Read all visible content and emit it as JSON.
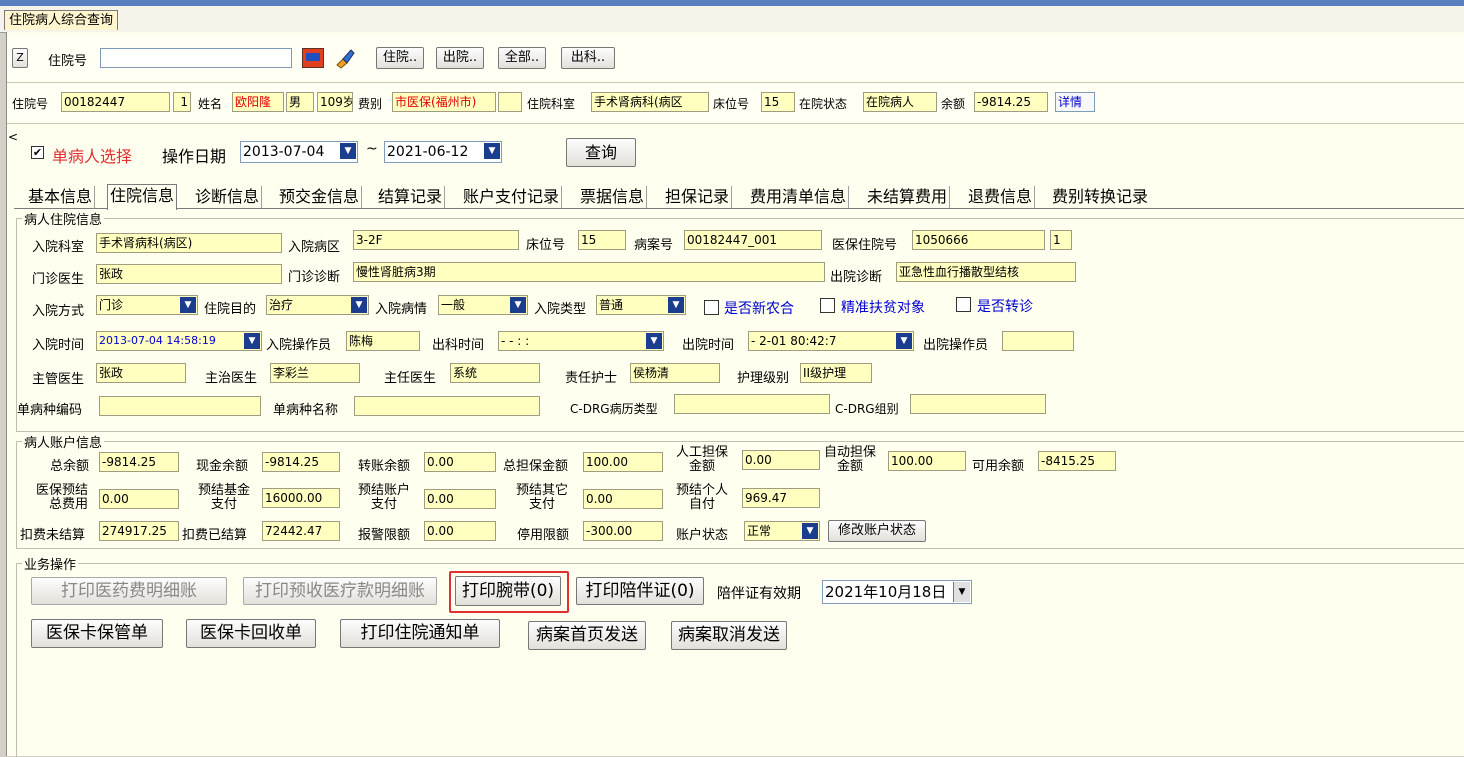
{
  "window": {
    "tab_title": "住院病人综合查询"
  },
  "search_bar": {
    "z_button": "Z",
    "admission_no_label": "住院号",
    "admission_no_value": "",
    "btn_inhospital": "住院..",
    "btn_discharged": "出院..",
    "btn_all": "全部..",
    "btn_out_dept": "出科.."
  },
  "patient_summary": {
    "admission_no_label": "住院号",
    "admission_no": "00182447",
    "times": "1",
    "name_label": "姓名",
    "name": "欧阳隆",
    "sex": "男",
    "age": "109岁",
    "fee_type_label": "费别",
    "fee_type": "市医保(福州市)",
    "dept_label": "住院科室",
    "dept": "手术肾病科(病区",
    "bed_label": "床位号",
    "bed": "15",
    "status_label": "在院状态",
    "status": "在院病人",
    "balance_label": "余额",
    "balance": "-9814.25",
    "detail_button": "详情"
  },
  "filter": {
    "collapse_glyph": "<",
    "single_patient_label": "单病人选择",
    "single_patient_checked": "✔",
    "op_date_label": "操作日期",
    "date_from": "2013-07-04",
    "tilde": "~",
    "date_to": "2021-06-12",
    "query_button": "查询"
  },
  "subtabs": [
    "基本信息",
    "住院信息",
    "诊断信息",
    "预交金信息",
    "结算记录",
    "账户支付记录",
    "票据信息",
    "担保记录",
    "费用清单信息",
    "未结算费用",
    "退费信息",
    "费别转换记录"
  ],
  "admission": {
    "group_title": "病人住院信息",
    "dept_label": "入院科室",
    "dept": "手术肾病科(病区)",
    "ward_label": "入院病区",
    "ward": "3-2F",
    "bed_label": "床位号",
    "bed": "15",
    "record_label": "病案号",
    "record": "00182447_001",
    "ins_no_label": "医保住院号",
    "ins_no": "1050666",
    "ins_seq": "1",
    "op_doctor_label": "门诊医生",
    "op_doctor": "张政",
    "op_diag_label": "门诊诊断",
    "op_diag": "慢性肾脏病3期",
    "dis_diag_label": "出院诊断",
    "dis_diag": "亚急性血行播散型结核",
    "way_label": "入院方式",
    "way": "门诊",
    "purpose_label": "住院目的",
    "purpose": "治疗",
    "cond_label": "入院病情",
    "cond": "一般",
    "type_label": "入院类型",
    "type": "普通",
    "new_coop_label": "是否新农合",
    "poverty_label": "精准扶贫对象",
    "transfer_label": "是否转诊",
    "adm_time_label": "入院时间",
    "adm_time": "2013-07-04 14:58:19",
    "adm_op_label": "入院操作员",
    "adm_op": "陈梅",
    "out_dept_time_label": "出科时间",
    "out_dept_time": "  -  -     :  :",
    "dis_time_label": "出院时间",
    "dis_time": "  - 2-01 80:42:7",
    "dis_op_label": "出院操作员",
    "dis_op": "",
    "chief_doctor_label": "主管医生",
    "chief_doctor": "张政",
    "attending_label": "主治医生",
    "attending": "李彩兰",
    "director_label": "主任医生",
    "director": "系统",
    "nurse_label": "责任护士",
    "nurse": "侯杨清",
    "care_level_label": "护理级别",
    "care_level": "II级护理",
    "disease_code_label": "单病种编码",
    "disease_code": "",
    "disease_name_label": "单病种名称",
    "disease_name": "",
    "cdrg_type_label": "C-DRG病历类型",
    "cdrg_type": "",
    "cdrg_group_label": "C-DRG组别",
    "cdrg_group": ""
  },
  "account": {
    "group_title": "病人账户信息",
    "total_balance_label": "总余额",
    "total_balance": "-9814.25",
    "cash_balance_label": "现金余额",
    "cash_balance": "-9814.25",
    "transfer_balance_label": "转账余额",
    "transfer_balance": "0.00",
    "total_guarantee_label": "总担保金额",
    "total_guarantee": "100.00",
    "manual_guarantee_label_1": "人工担保",
    "manual_guarantee_label_2": "金额",
    "manual_guarantee": "0.00",
    "auto_guarantee_label_1": "自动担保",
    "auto_guarantee_label_2": "金额",
    "auto_guarantee": "100.00",
    "available_label": "可用余额",
    "available": "-8415.25",
    "ins_pre_total_label_1": "医保预结",
    "ins_pre_total_label_2": "总费用",
    "ins_pre_total": "0.00",
    "pre_fund_label_1": "预结基金",
    "pre_fund_label_2": "支付",
    "pre_fund": "16000.00",
    "pre_account_label_1": "预结账户",
    "pre_account_label_2": "支付",
    "pre_account": "0.00",
    "pre_other_label_1": "预结其它",
    "pre_other_label_2": "支付",
    "pre_other": "0.00",
    "pre_self_label_1": "预结个人",
    "pre_self_label_2": "自付",
    "pre_self": "969.47",
    "unsettled_label": "扣费未结算",
    "unsettled": "274917.25",
    "settled_label": "扣费已结算",
    "settled": "72442.47",
    "alarm_label": "报警限额",
    "alarm": "0.00",
    "stop_label": "停用限额",
    "stop": "-300.00",
    "acct_status_label": "账户状态",
    "acct_status": "正常",
    "modify_status_button": "修改账户状态"
  },
  "operations": {
    "group_title": "业务操作",
    "btn_print_drug_detail": "打印医药费明细账",
    "btn_print_prepay_detail": "打印预收医疗款明细账",
    "btn_print_wristband": "打印腕带(0)",
    "btn_print_escort": "打印陪伴证(0)",
    "escort_valid_label": "陪伴证有效期",
    "escort_valid_date": "2021年10月18日",
    "btn_ins_card_keep": "医保卡保管单",
    "btn_ins_card_return": "医保卡回收单",
    "btn_print_notice": "打印住院通知单",
    "btn_record_send": "病案首页发送",
    "btn_record_cancel": "病案取消发送"
  }
}
